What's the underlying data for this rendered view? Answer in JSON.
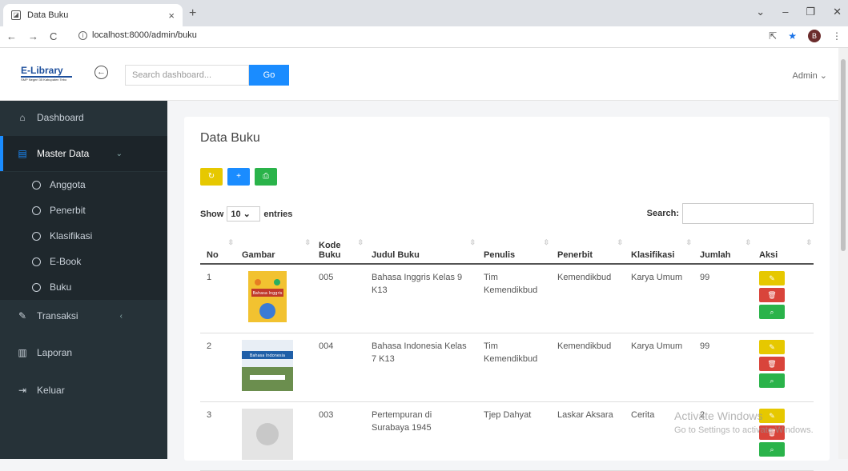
{
  "browser": {
    "tab_title": "Data Buku",
    "url": "localhost:8000/admin/buku",
    "profile": "B"
  },
  "header": {
    "logo": "E-Library",
    "logo_sub": "SMP Negeri 35 Kabupaten Tebo",
    "search_placeholder": "Search dashboard...",
    "go": "Go",
    "user": "Admin"
  },
  "sidebar": {
    "dashboard": "Dashboard",
    "master": "Master Data",
    "transaksi": "Transaksi",
    "laporan": "Laporan",
    "keluar": "Keluar",
    "subs": [
      "Anggota",
      "Penerbit",
      "Klasifikasi",
      "E-Book",
      "Buku"
    ]
  },
  "main": {
    "title": "Data Buku",
    "show": "Show",
    "entries_value": "10",
    "entries": "entries",
    "search": "Search:",
    "columns": [
      "No",
      "Gambar",
      "Kode Buku",
      "Judul Buku",
      "Penulis",
      "Penerbit",
      "Klasifikasi",
      "Jumlah",
      "Aksi"
    ],
    "rows": [
      {
        "no": "1",
        "kode": "005",
        "judul": "Bahasa Inggris Kelas 9 K13",
        "penulis": "Tim Kemendikbud",
        "penerbit": "Kemendikbud",
        "klasifikasi": "Karya Umum",
        "jumlah": "99",
        "cover_text": "Bahasa Inggris"
      },
      {
        "no": "2",
        "kode": "004",
        "judul": "Bahasa Indonesia Kelas 7 K13",
        "penulis": "Tim Kemendikbud",
        "penerbit": "Kemendikbud",
        "klasifikasi": "Karya Umum",
        "jumlah": "99",
        "cover_text": "Bahasa Indonesia"
      },
      {
        "no": "3",
        "kode": "003",
        "judul": "Pertempuran di Surabaya 1945",
        "penulis": "Tjep Dahyat",
        "penerbit": "Laskar Aksara",
        "klasifikasi": "Cerita",
        "jumlah": "2"
      }
    ]
  },
  "watermark": {
    "l1": "Activate Windows",
    "l2": "Go to Settings to activate Windows."
  },
  "colors": {
    "primary": "#1a8cff",
    "warning": "#e6c800",
    "danger": "#d9443b",
    "success": "#2ab34a",
    "sidebar": "#263238"
  }
}
